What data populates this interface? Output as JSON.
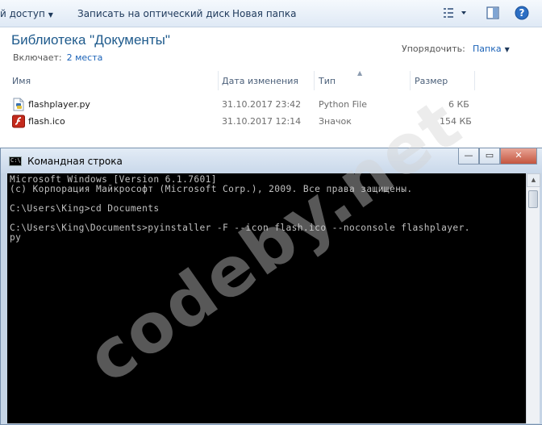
{
  "toolbar": {
    "share_label": "й доступ",
    "burn_label": "Записать на оптический диск",
    "new_folder_label": "Новая папка",
    "view_icon": "view-options-icon",
    "preview_icon": "preview-pane-icon",
    "help_icon": "help-icon"
  },
  "library": {
    "title": "Библиотека \"Документы\"",
    "includes_label": "Включает:",
    "includes_link": "2 места",
    "arrange_label": "Упорядочить:",
    "arrange_value": "Папка"
  },
  "columns": {
    "name": "Имя",
    "date": "Дата изменения",
    "type": "Тип",
    "size": "Размер"
  },
  "files": [
    {
      "name": "flashplayer.py",
      "date": "31.10.2017 23:42",
      "type": "Python File",
      "size": "6 КБ",
      "icon": "python-file-icon"
    },
    {
      "name": "flash.ico",
      "date": "31.10.2017 12:14",
      "type": "Значок",
      "size": "154 КБ",
      "icon": "flash-icon"
    }
  ],
  "cmd": {
    "title": "Командная строка",
    "icon_text": "C:\\",
    "lines": [
      "Microsoft Windows [Version 6.1.7601]",
      "(c) Корпорация Майкрософт (Microsoft Corp.), 2009. Все права защищены.",
      "",
      "C:\\Users\\King>cd Documents",
      "",
      "C:\\Users\\King\\Documents>pyinstaller -F --icon flash.ico --noconsole flashplayer.",
      "py"
    ]
  },
  "watermark": "codeby.net"
}
